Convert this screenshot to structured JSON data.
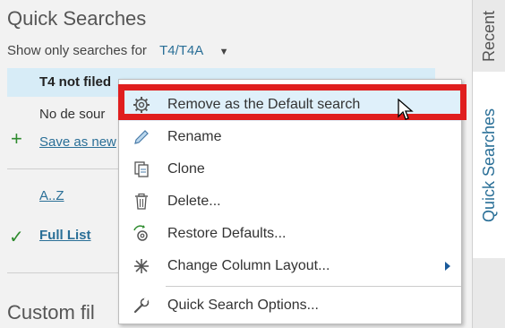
{
  "panel": {
    "title": "Quick Searches",
    "filter_label": "Show only searches for",
    "filter_value": "T4/T4A",
    "selected_item": "T4 not filed",
    "second_item": "No de sour",
    "save_link": "Save as new",
    "az_link": "A..Z",
    "full_list_link": "Full List",
    "custom_heading": "Custom fil"
  },
  "tabs": {
    "recent": "Recent",
    "quick_searches": "Quick Searches"
  },
  "menu": {
    "items": [
      {
        "label": "Remove as the Default search",
        "icon": "gear-icon"
      },
      {
        "label": "Rename",
        "icon": "pencil-icon"
      },
      {
        "label": "Clone",
        "icon": "clone-icon"
      },
      {
        "label": "Delete...",
        "icon": "trash-icon"
      },
      {
        "label": "Restore Defaults...",
        "icon": "restore-gear-icon"
      },
      {
        "label": "Change Column Layout...",
        "icon": "columns-icon"
      },
      {
        "label": "Quick Search Options...",
        "icon": "wrench-icon"
      }
    ]
  },
  "colors": {
    "accent": "#2a6f97",
    "highlight": "#e01e1e",
    "selected_row": "#d7ecf7",
    "green": "#2e8b2e"
  }
}
